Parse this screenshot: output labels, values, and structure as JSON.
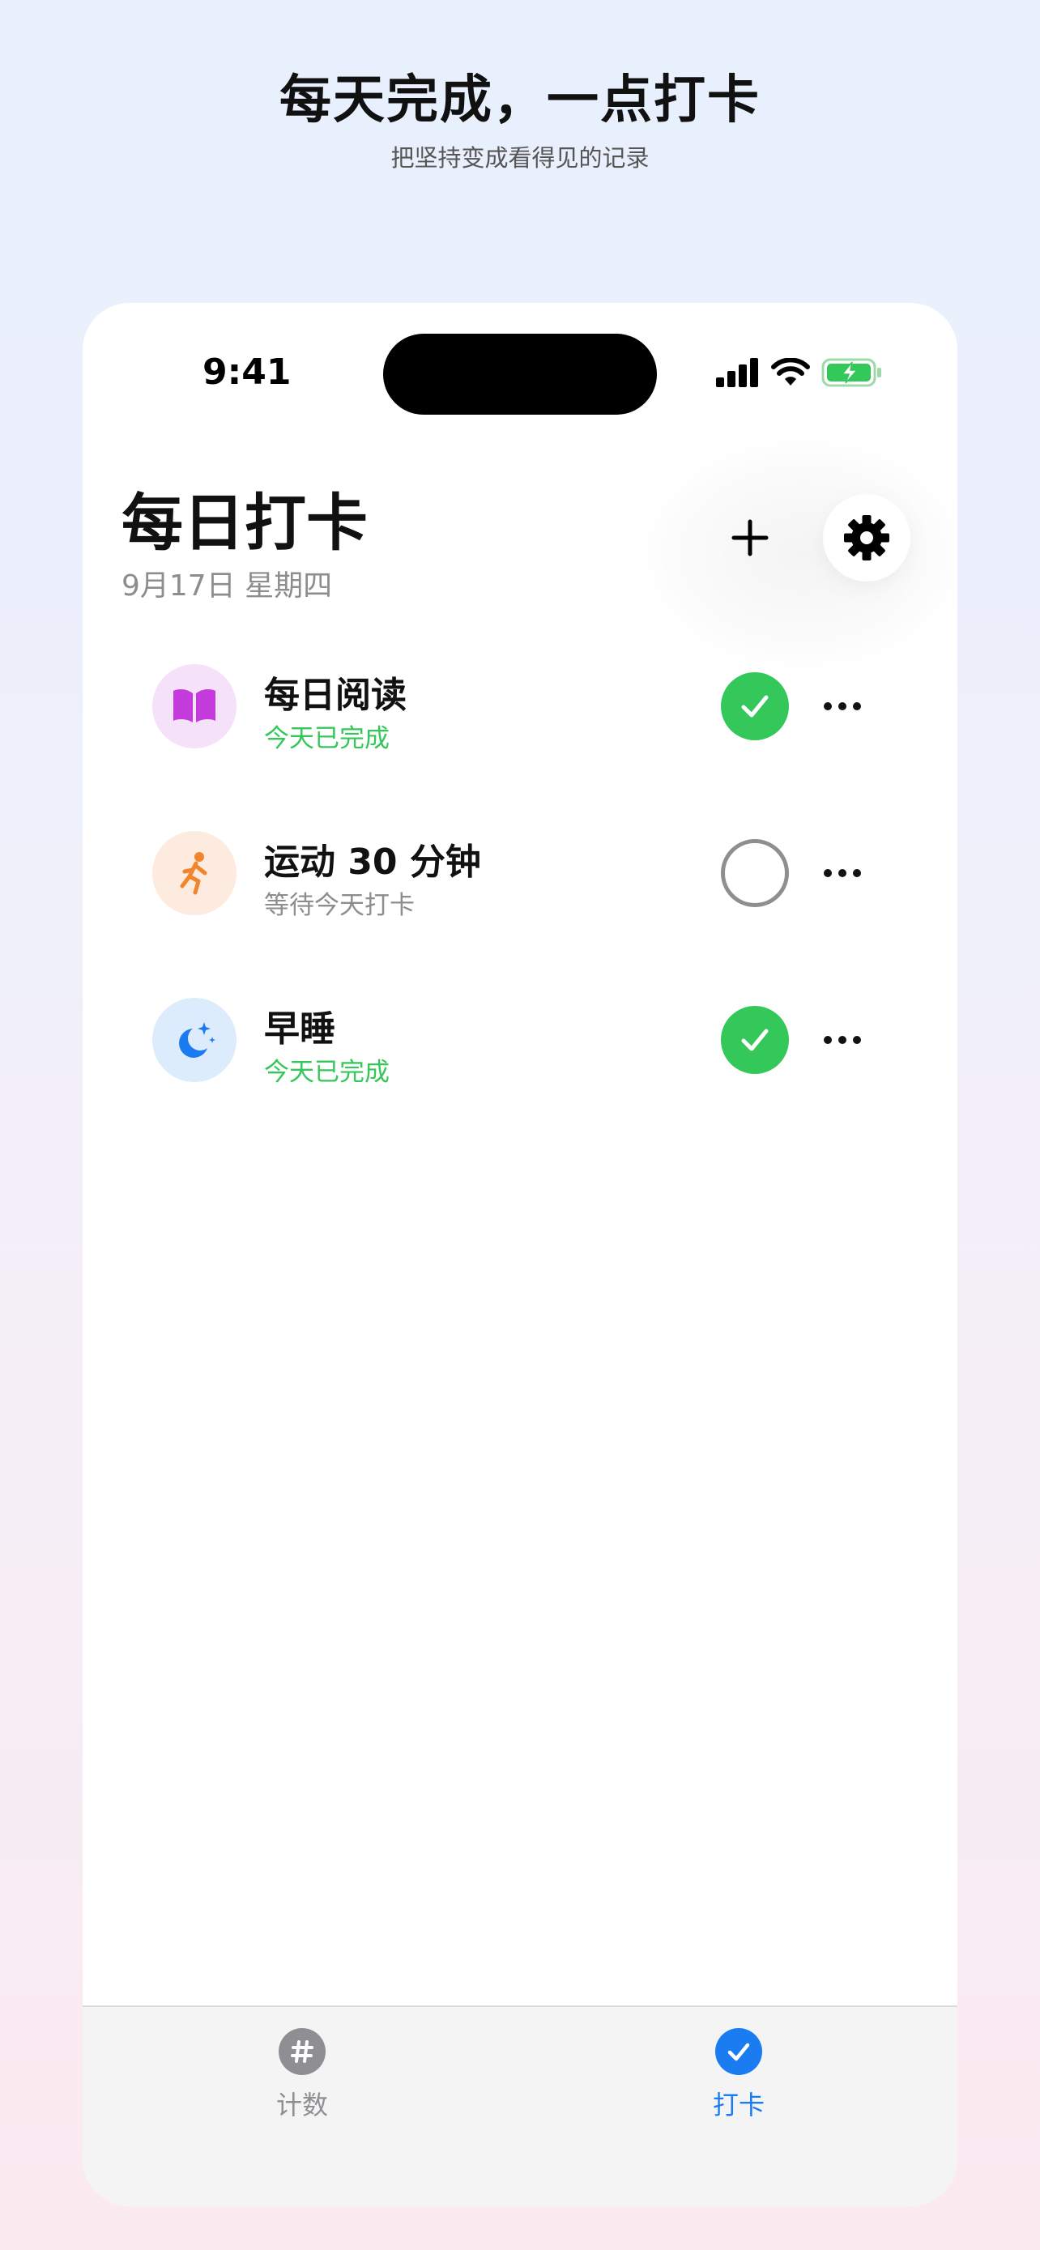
{
  "hero": {
    "title": "每天完成，一点打卡",
    "subtitle": "把坚持变成看得见的记录"
  },
  "status_bar": {
    "time": "9:41"
  },
  "header": {
    "title": "每日打卡",
    "date": "9月17日 星期四",
    "add_icon": "plus-icon",
    "settings_icon": "gear-icon"
  },
  "habits": [
    {
      "name": "每日阅读",
      "status": "今天已完成",
      "done": true,
      "icon": "book-icon",
      "icon_bg": "#f6e1fb",
      "icon_color": "#c43bdc",
      "status_color": "#34c759"
    },
    {
      "name": "运动 30 分钟",
      "status": "等待今天打卡",
      "done": false,
      "icon": "running-figure-icon",
      "icon_bg": "#fdebdf",
      "icon_color": "#f0852d",
      "status_color": "#8d8d8d"
    },
    {
      "name": "早睡",
      "status": "今天已完成",
      "done": true,
      "icon": "moon-stars-icon",
      "icon_bg": "#dcecfc",
      "icon_color": "#1a7cf0",
      "status_color": "#34c759"
    }
  ],
  "tabbar": {
    "tabs": [
      {
        "label": "计数",
        "icon": "hash-icon",
        "active": false
      },
      {
        "label": "打卡",
        "icon": "checkmark-icon",
        "active": true
      }
    ]
  },
  "colors": {
    "accent": "#1a7cf0",
    "success": "#34c759",
    "inactive": "#8e8e93"
  }
}
